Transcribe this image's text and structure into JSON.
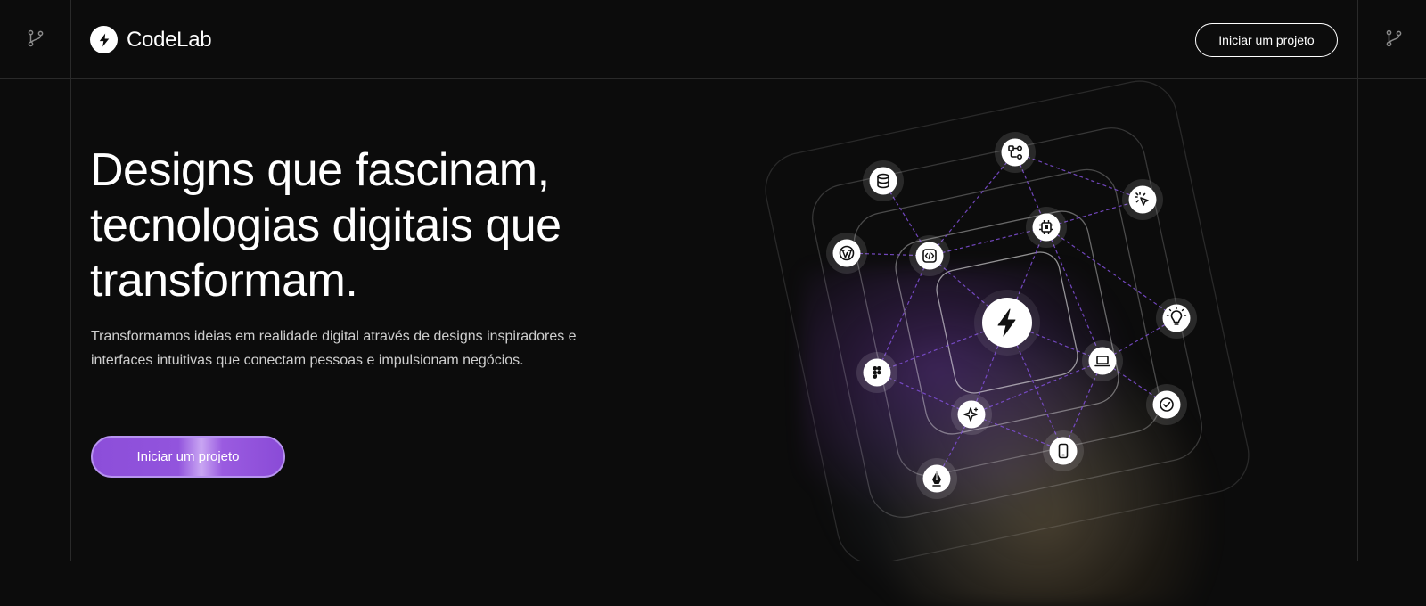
{
  "header": {
    "brand": "CodeLab",
    "cta_label": "Iniciar um projeto"
  },
  "hero": {
    "title_lines": [
      "Designs que fascinam,",
      "tecnologias digitais que",
      "transformam."
    ],
    "subtitle": "Transformamos ideias em realidade digital através de designs inspiradores e interfaces intuitivas que conectam pessoas e impulsionam negócios.",
    "cta_label": "Iniciar um projeto"
  },
  "colors": {
    "background": "#0c0c0c",
    "accent_purple": "#8c4ed9",
    "dash_purple": "#7c4dd0",
    "node_white": "#ffffff"
  },
  "network": {
    "center_icon": "lightning-bolt-icon",
    "nodes": [
      {
        "id": "database",
        "icon": "database-icon"
      },
      {
        "id": "workflow",
        "icon": "workflow-icon"
      },
      {
        "id": "cursor",
        "icon": "cursor-click-icon"
      },
      {
        "id": "wordpress",
        "icon": "wordpress-icon"
      },
      {
        "id": "code",
        "icon": "code-icon"
      },
      {
        "id": "chip",
        "icon": "chip-icon"
      },
      {
        "id": "bulb",
        "icon": "lightbulb-icon"
      },
      {
        "id": "figma",
        "icon": "figma-icon"
      },
      {
        "id": "laptop",
        "icon": "laptop-icon"
      },
      {
        "id": "check",
        "icon": "check-circle-icon"
      },
      {
        "id": "sparkle",
        "icon": "sparkle-icon"
      },
      {
        "id": "mobile",
        "icon": "mobile-icon"
      },
      {
        "id": "pen",
        "icon": "pen-nib-icon"
      }
    ]
  }
}
